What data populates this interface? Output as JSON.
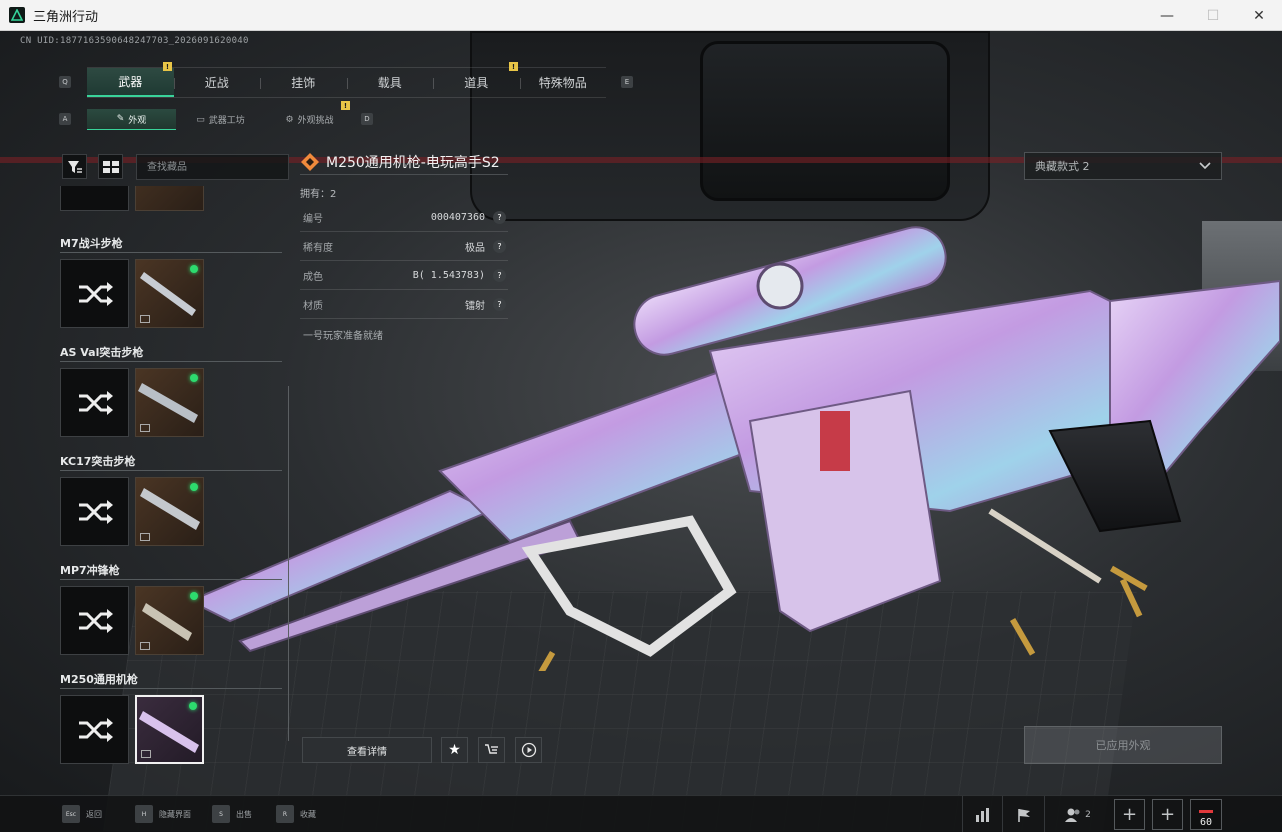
{
  "window": {
    "title": "三角洲行动",
    "minimize": "—",
    "maximize": "☐",
    "close": "✕"
  },
  "uid": "CN UID:1877163590648247703_2026091620040",
  "nav": {
    "key_left": "Q",
    "key_right": "E",
    "tabs": [
      {
        "label": "武器",
        "active": true,
        "badge": "!"
      },
      {
        "label": "近战"
      },
      {
        "label": "挂饰"
      },
      {
        "label": "载具"
      },
      {
        "label": "道具",
        "badge": "!"
      },
      {
        "label": "特殊物品"
      }
    ]
  },
  "subnav": {
    "key_left": "A",
    "key_right": "D",
    "tabs": [
      {
        "label": "外观",
        "active": true
      },
      {
        "label": "武器工坊"
      },
      {
        "label": "外观挑战",
        "badge": "!"
      }
    ]
  },
  "search": {
    "placeholder": "查找藏品"
  },
  "weapons": [
    {
      "name": "M7战斗步枪",
      "equipped": true
    },
    {
      "name": "AS Val突击步枪",
      "equipped": true
    },
    {
      "name": "KC17突击步枪",
      "equipped": true
    },
    {
      "name": "MP7冲锋枪",
      "equipped": true
    },
    {
      "name": "M250通用机枪",
      "equipped": true,
      "selected": true
    }
  ],
  "info": {
    "title": "M250通用机枪-电玩高手S2",
    "owned": "拥有：2",
    "stats": [
      {
        "label": "编号",
        "value": "000407360"
      },
      {
        "label": "稀有度",
        "value": "极品"
      },
      {
        "label": "成色",
        "value": "B( 1.543783)"
      },
      {
        "label": "材质",
        "value": "镭射"
      }
    ],
    "description": "一号玩家准备就绪"
  },
  "actions": {
    "detail": "查看详情"
  },
  "preset": {
    "label": "典藏款式 2"
  },
  "apply": {
    "label": "已应用外观"
  },
  "footer": {
    "hints": [
      {
        "key": "Esc",
        "label": "返回"
      },
      {
        "key": "H",
        "label": "隐藏界面"
      },
      {
        "key": "S",
        "label": "出售"
      },
      {
        "key": "R",
        "label": "收藏"
      }
    ],
    "party_count": "2",
    "fps": "60"
  },
  "colors": {
    "accent": "#39d39a",
    "badge": "#e8c547",
    "equipped_dot": "#2ddb6e",
    "gun_body": "#c9a7e6"
  }
}
